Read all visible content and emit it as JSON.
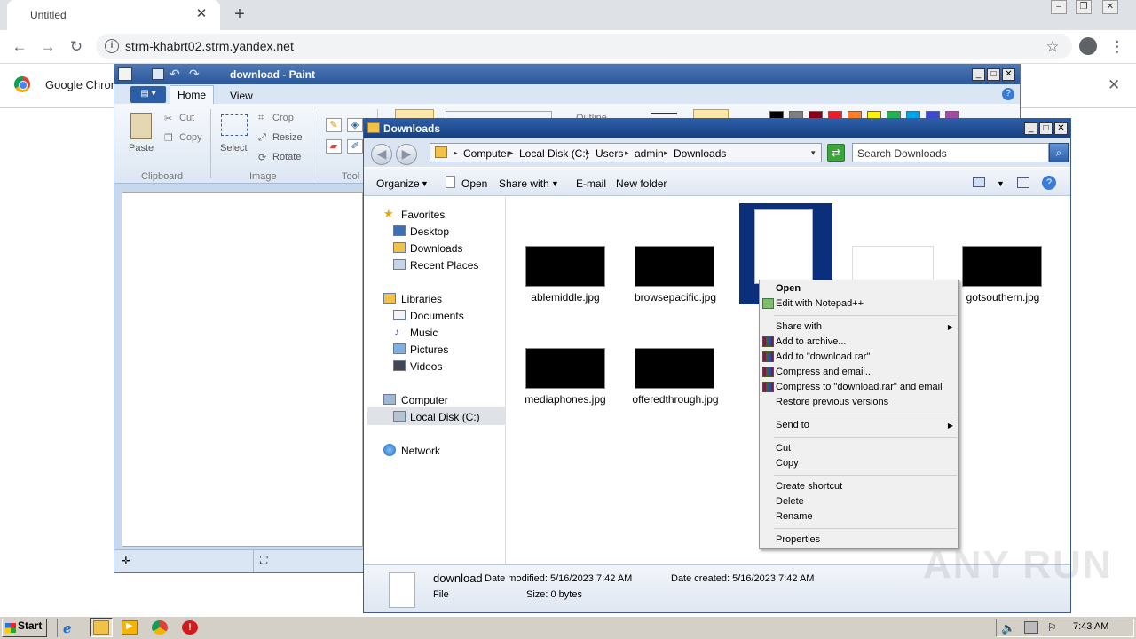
{
  "browser": {
    "tab_title": "Untitled",
    "tab_close": "✕",
    "new_tab": "+",
    "url": "strm-khabrt02.strm.yandex.net",
    "infobar_text": "Google Chrom",
    "infobar_close": "✕",
    "nav": {
      "back": "←",
      "forward": "→",
      "reload": "↻",
      "star": "☆",
      "menu": "⋮",
      "info": "i"
    }
  },
  "paint": {
    "title": "download - Paint",
    "tabs": {
      "home": "Home",
      "view": "View"
    },
    "help": "?",
    "clipboard": {
      "paste": "Paste",
      "cut": "Cut",
      "copy": "Copy",
      "group": "Clipboard"
    },
    "image": {
      "select": "Select",
      "crop": "Crop",
      "resize": "Resize",
      "rotate": "Rotate",
      "group": "Image"
    },
    "tools_group": "Tool",
    "outline": "Outline",
    "palette": [
      "#000000",
      "#7f7f7f",
      "#880015",
      "#ed1c24",
      "#ff7f27",
      "#fff200",
      "#22b14c",
      "#00a2e8",
      "#3f48cc",
      "#a349a4"
    ]
  },
  "explorer": {
    "title": "Downloads",
    "breadcrumbs": [
      "Computer",
      "Local Disk (C:)",
      "Users",
      "admin",
      "Downloads"
    ],
    "search_placeholder": "Search Downloads",
    "commands": {
      "organize": "Organize",
      "open": "Open",
      "share_with": "Share with",
      "email": "E-mail",
      "new_folder": "New folder"
    },
    "nav": {
      "favorites": "Favorites",
      "desktop": "Desktop",
      "downloads": "Downloads",
      "recent_places": "Recent Places",
      "libraries": "Libraries",
      "documents": "Documents",
      "music": "Music",
      "pictures": "Pictures",
      "videos": "Videos",
      "computer": "Computer",
      "local_disk": "Local Disk (C:)",
      "network": "Network"
    },
    "files": [
      {
        "name": "ablemiddle.jpg"
      },
      {
        "name": "browsepacific.jpg"
      },
      {
        "name": "gotsouthern.jpg"
      },
      {
        "name": "mediaphones.jpg"
      },
      {
        "name": "offeredthrough.jpg"
      }
    ],
    "details": {
      "name": "download",
      "type": "File",
      "date_modified": "Date modified: 5/16/2023 7:42 AM",
      "date_created": "Date created: 5/16/2023 7:42 AM",
      "size": "Size: 0 bytes"
    }
  },
  "context_menu": {
    "open": "Open",
    "edit_notepad": "Edit with Notepad++",
    "share_with": "Share with",
    "add_archive": "Add to archive...",
    "add_rar": "Add to \"download.rar\"",
    "compress_email": "Compress and email...",
    "compress_rar_email": "Compress to \"download.rar\" and email",
    "restore": "Restore previous versions",
    "send_to": "Send to",
    "cut": "Cut",
    "copy": "Copy",
    "create_shortcut": "Create shortcut",
    "delete": "Delete",
    "rename": "Rename",
    "properties": "Properties"
  },
  "taskbar": {
    "start": "Start",
    "clock": "7:43 AM"
  },
  "watermark": "ANY RUN"
}
